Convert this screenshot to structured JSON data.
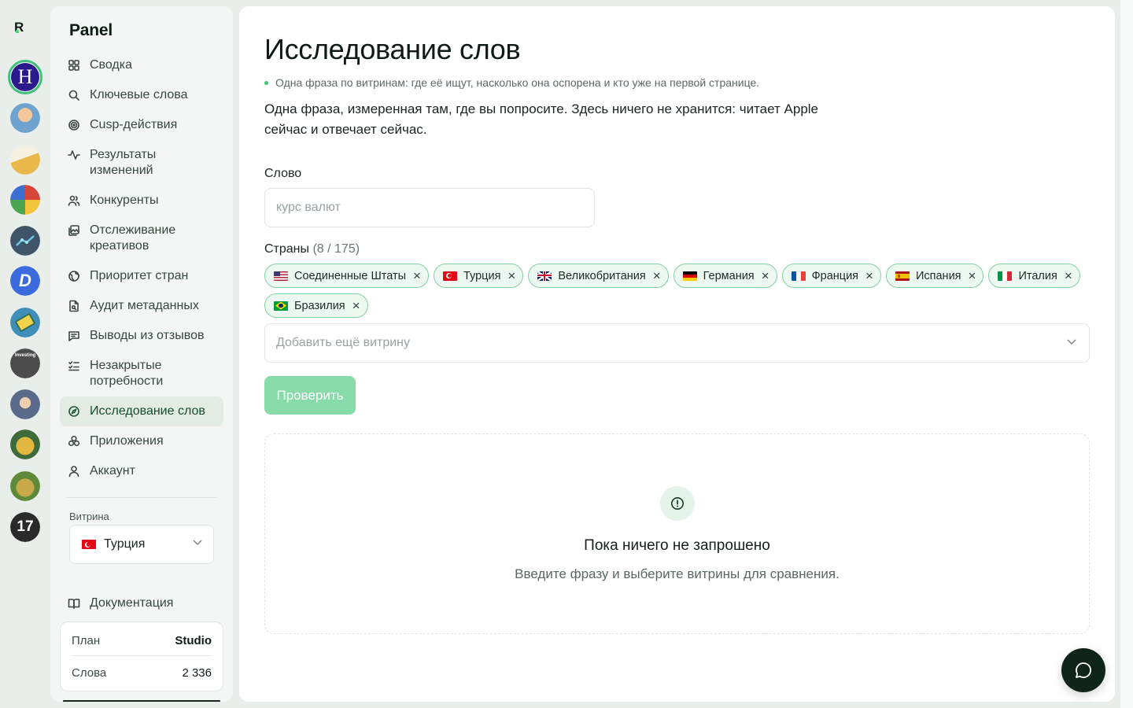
{
  "rail": {
    "logo_text": "R",
    "apps": [
      {
        "name": "H",
        "color": "#2a1a8c",
        "active": true
      },
      {
        "name": "",
        "color": "#7aa6c8"
      },
      {
        "name": "",
        "color": "#e8c463"
      },
      {
        "name": "",
        "color": "#c84a3a"
      },
      {
        "name": "",
        "color": "#3e5468"
      },
      {
        "name": "D",
        "color": "#3b6bdc"
      },
      {
        "name": "",
        "color": "#3f8fb8"
      },
      {
        "name": "Investing",
        "color": "#4c4c4c"
      },
      {
        "name": "",
        "color": "#5a6a8a"
      },
      {
        "name": "",
        "color": "#3d6a3a"
      },
      {
        "name": "",
        "color": "#5f8a3a"
      },
      {
        "name": "17",
        "color": "#1c1c1c"
      }
    ]
  },
  "sidebar": {
    "brand": "Panel",
    "items": [
      {
        "label": "Сводка",
        "icon": "grid-icon"
      },
      {
        "label": "Ключевые слова",
        "icon": "search-icon"
      },
      {
        "label": "Cusp-действия",
        "icon": "target-icon"
      },
      {
        "label": "Результаты изменений",
        "icon": "activity-icon"
      },
      {
        "label": "Конкуренты",
        "icon": "users-icon"
      },
      {
        "label": "Отслеживание креативов",
        "icon": "images-icon"
      },
      {
        "label": "Приоритет стран",
        "icon": "globe-icon"
      },
      {
        "label": "Аудит метаданных",
        "icon": "file-search-icon"
      },
      {
        "label": "Выводы из отзывов",
        "icon": "message-icon"
      },
      {
        "label": "Незакрытые потребности",
        "icon": "list-check-icon"
      },
      {
        "label": "Исследование слов",
        "icon": "compass-icon",
        "active": true
      },
      {
        "label": "Приложения",
        "icon": "apps-icon"
      },
      {
        "label": "Аккаунт",
        "icon": "user-icon"
      }
    ],
    "store_label": "Витрина",
    "store_value": "Турция",
    "docs_label": "Документация",
    "plan": {
      "plan_label": "План",
      "plan_value": "Studio",
      "words_label": "Слова",
      "words_value": "2 336"
    }
  },
  "main": {
    "title": "Исследование слов",
    "subtitle": "Одна фраза по витринам: где её ищут, насколько она оспорена и кто уже на первой странице.",
    "description": "Одна фраза, измеренная там, где вы попросите. Здесь ничего не хранится: читает Apple сейчас и отвечает сейчас.",
    "word_label": "Слово",
    "word_placeholder": "курс валют",
    "word_value": "",
    "countries_label": "Страны",
    "countries_count": "(8 / 175)",
    "countries": [
      {
        "label": "Соединенные Штаты",
        "flag": "us"
      },
      {
        "label": "Турция",
        "flag": "tr"
      },
      {
        "label": "Великобритания",
        "flag": "gb"
      },
      {
        "label": "Германия",
        "flag": "de"
      },
      {
        "label": "Франция",
        "flag": "fr"
      },
      {
        "label": "Испания",
        "flag": "es"
      },
      {
        "label": "Италия",
        "flag": "it"
      },
      {
        "label": "Бразилия",
        "flag": "br"
      }
    ],
    "add_store_placeholder": "Добавить ещё витрину",
    "check_button": "Проверить",
    "empty_title": "Пока ничего не запрошено",
    "empty_subtitle": "Введите фразу и выберите витрины для сравнения."
  },
  "colors": {
    "accent": "#3ec17a",
    "button_disabled": "#87dba9",
    "chip_border": "#7fd3a0",
    "chip_bg": "#edf8f1",
    "chat_button": "#10251a"
  }
}
